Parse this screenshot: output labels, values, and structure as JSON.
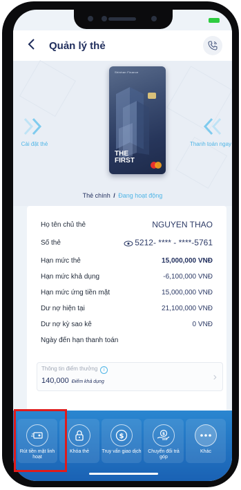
{
  "header": {
    "title": "Quản lý thẻ",
    "back_icon": "chevron-left-icon",
    "call_icon": "phone-call-icon"
  },
  "card_section": {
    "left_action": "Cài đặt thẻ",
    "right_action": "Thanh toán ngay",
    "card_brand": "Shinhan Finance",
    "card_name_line1": "THE",
    "card_name_line2": "FIRST",
    "card_type": "Thẻ chính",
    "card_status": "Đang hoạt động",
    "accent_color": "#4fb5e6"
  },
  "info": {
    "rows": [
      {
        "label": "Họ tên chủ thẻ",
        "value": "NGUYEN THAO"
      },
      {
        "label": "Số thẻ",
        "value": "5212- **** - ****-5761"
      },
      {
        "label": "Hạn mức thẻ",
        "value": "15,000,000 VNĐ"
      },
      {
        "label": "Hạn mức khả dụng",
        "value": "-6,100,000 VNĐ"
      },
      {
        "label": "Hạn mức ứng tiền mặt",
        "value": "15,000,000 VNĐ"
      },
      {
        "label": "Dư nợ hiện tại",
        "value": "21,100,000 VNĐ"
      },
      {
        "label": "Dư nợ kỳ sao kê",
        "value": "0 VNĐ"
      },
      {
        "label": "Ngày đến hạn thanh toán",
        "value": ""
      }
    ]
  },
  "points": {
    "label": "Thông tin điểm thưởng",
    "value": "140,000",
    "unit": "Điểm khả dụng"
  },
  "actions": [
    {
      "label": "Rút tiền mặt linh hoạt",
      "icon": "cash-withdraw-icon"
    },
    {
      "label": "Khóa thẻ",
      "icon": "lock-icon"
    },
    {
      "label": "Truy vấn giao dịch",
      "icon": "dollar-icon"
    },
    {
      "label": "Chuyển đổi trả góp",
      "icon": "installment-icon"
    },
    {
      "label": "Khác",
      "icon": "more-icon"
    }
  ],
  "colors": {
    "primary_dark": "#1f2d5c",
    "bottom_bar": "#1a62b4",
    "highlight": "#e01b1b"
  }
}
